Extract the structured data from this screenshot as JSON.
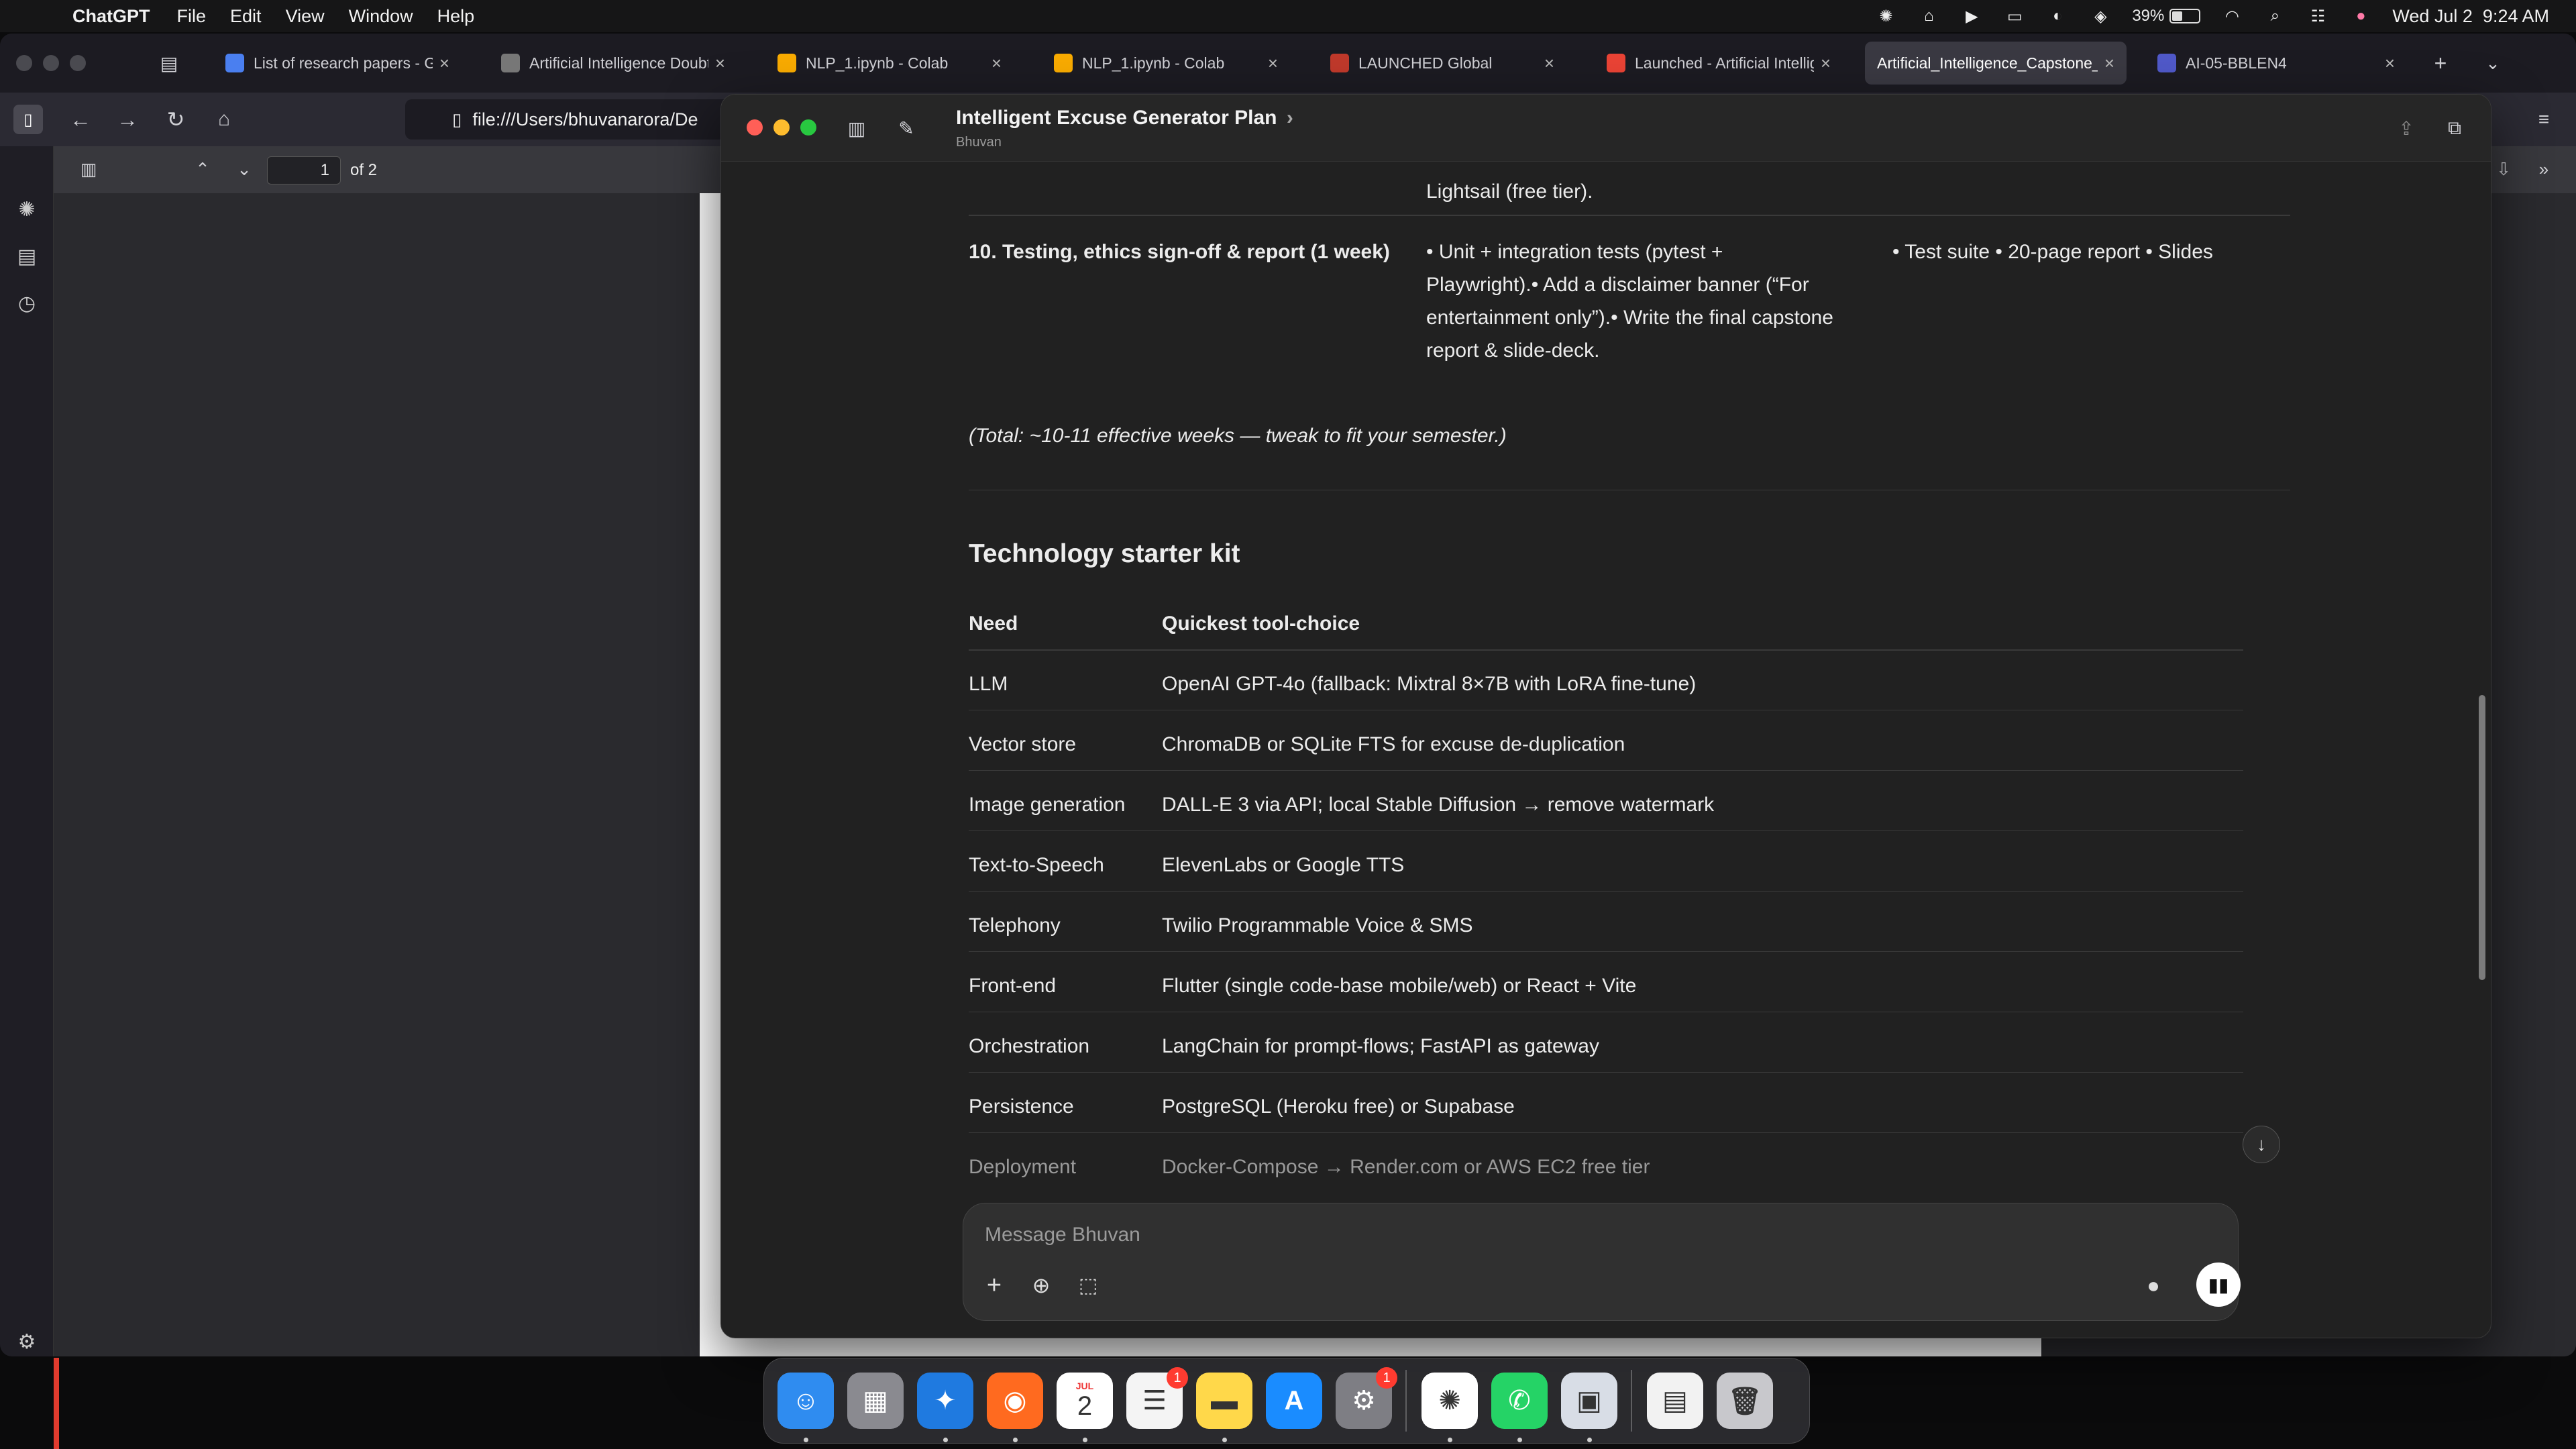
{
  "menubar": {
    "app_name": "ChatGPT",
    "menus": [
      "File",
      "Edit",
      "View",
      "Window",
      "Help"
    ],
    "battery": "39%",
    "datetime": "Wed Jul 2  9:24 AM"
  },
  "browser": {
    "tabs": [
      {
        "label": "List of research papers - Go",
        "icon": "docs-icon",
        "color": "#4a7ff0"
      },
      {
        "label": "Artificial Intelligence Doubt S",
        "icon": "classroom-icon",
        "color": "#777777"
      },
      {
        "label": "NLP_1.ipynb - Colab",
        "icon": "colab-icon",
        "color": "#f9ab00"
      },
      {
        "label": "NLP_1.ipynb - Colab",
        "icon": "colab-icon",
        "color": "#f9ab00"
      },
      {
        "label": "LAUNCHED Global",
        "icon": "launched-icon",
        "color": "#c0392b"
      },
      {
        "label": "Launched - Artificial Intellig",
        "icon": "gmail-icon",
        "color": "#ea4335"
      },
      {
        "label": "Artificial_Intelligence_Capstone_",
        "icon": "none",
        "color": "#3a3942"
      },
      {
        "label": "AI-05-BBLEN4",
        "icon": "teams-icon",
        "color": "#5059c9"
      }
    ],
    "url": "file:///Users/bhuvanarora/De",
    "pdf_page": "1",
    "pdf_total": "of 2"
  },
  "chat": {
    "title": "Intelligent Excuse Generator Plan",
    "subtitle": "Bhuvan",
    "partial_text": "Lightsail (free tier).",
    "row10": {
      "phase": "10. Testing, ethics sign-off & report (1 week)",
      "tasks": [
        "• Unit + integration tests (pytest +",
        "Playwright).• Add a disclaimer banner (“For",
        "entertainment only”).• Write the final capstone",
        "report & slide-deck."
      ],
      "deliverables": "• Test suite • 20-page report • Slides"
    },
    "total_note": "(Total: ~10-11 effective weeks — tweak to fit your semester.)",
    "section_heading": "Technology starter kit",
    "table_headers": [
      "Need",
      "Quickest tool-choice"
    ],
    "table_rows": [
      [
        "LLM",
        "OpenAI GPT-4o (fallback: Mixtral 8×7B with LoRA fine-tune)"
      ],
      [
        "Vector store",
        "ChromaDB or SQLite FTS for excuse de-duplication"
      ],
      [
        "Image generation",
        "DALL-E 3 via API; local Stable Diffusion → remove watermark"
      ],
      [
        "Text-to-Speech",
        "ElevenLabs or Google TTS"
      ],
      [
        "Telephony",
        "Twilio Programmable Voice & SMS"
      ],
      [
        "Front-end",
        "Flutter (single code-base mobile/web) or React + Vite"
      ],
      [
        "Orchestration",
        "LangChain for prompt-flows; FastAPI as gateway"
      ],
      [
        "Persistence",
        "PostgreSQL (Heroku free) or Supabase"
      ],
      [
        "Deployment",
        "Docker-Compose → Render.com or AWS EC2 free tier"
      ]
    ],
    "composer_placeholder": "Message Bhuvan"
  },
  "dock": {
    "apps": [
      {
        "name": "finder-icon",
        "color": "#2f8cf0",
        "glyph": "☺"
      },
      {
        "name": "launchpad-icon",
        "color": "#8a8a90",
        "glyph": "▦"
      },
      {
        "name": "safari-icon",
        "color": "#1f7ae0",
        "glyph": "✦"
      },
      {
        "name": "firefox-icon",
        "color": "#ff6a1f",
        "glyph": "◉"
      },
      {
        "name": "calendar-icon",
        "color": "#ffffff",
        "glyph": "2"
      },
      {
        "name": "reminders-icon",
        "color": "#f4f4f4",
        "glyph": "☰",
        "badge": "1"
      },
      {
        "name": "notes-icon",
        "color": "#ffd84a",
        "glyph": "▬"
      },
      {
        "name": "app-store-icon",
        "color": "#1a8cff",
        "glyph": "A"
      },
      {
        "name": "system-settings-icon",
        "color": "#7e7e84",
        "glyph": "⚙",
        "badge": "1"
      },
      {
        "name": "chatgpt-icon",
        "color": "#ffffff",
        "glyph": "✺"
      },
      {
        "name": "whatsapp-icon",
        "color": "#25d366",
        "glyph": "✆"
      },
      {
        "name": "preview-icon",
        "color": "#d8dde6",
        "glyph": "▣"
      },
      {
        "name": "document-icon",
        "color": "#f2f2f2",
        "glyph": "▤"
      },
      {
        "name": "trash-icon",
        "color": "#c8c8cc",
        "glyph": "🗑"
      }
    ],
    "calendar_month": "JUL"
  }
}
